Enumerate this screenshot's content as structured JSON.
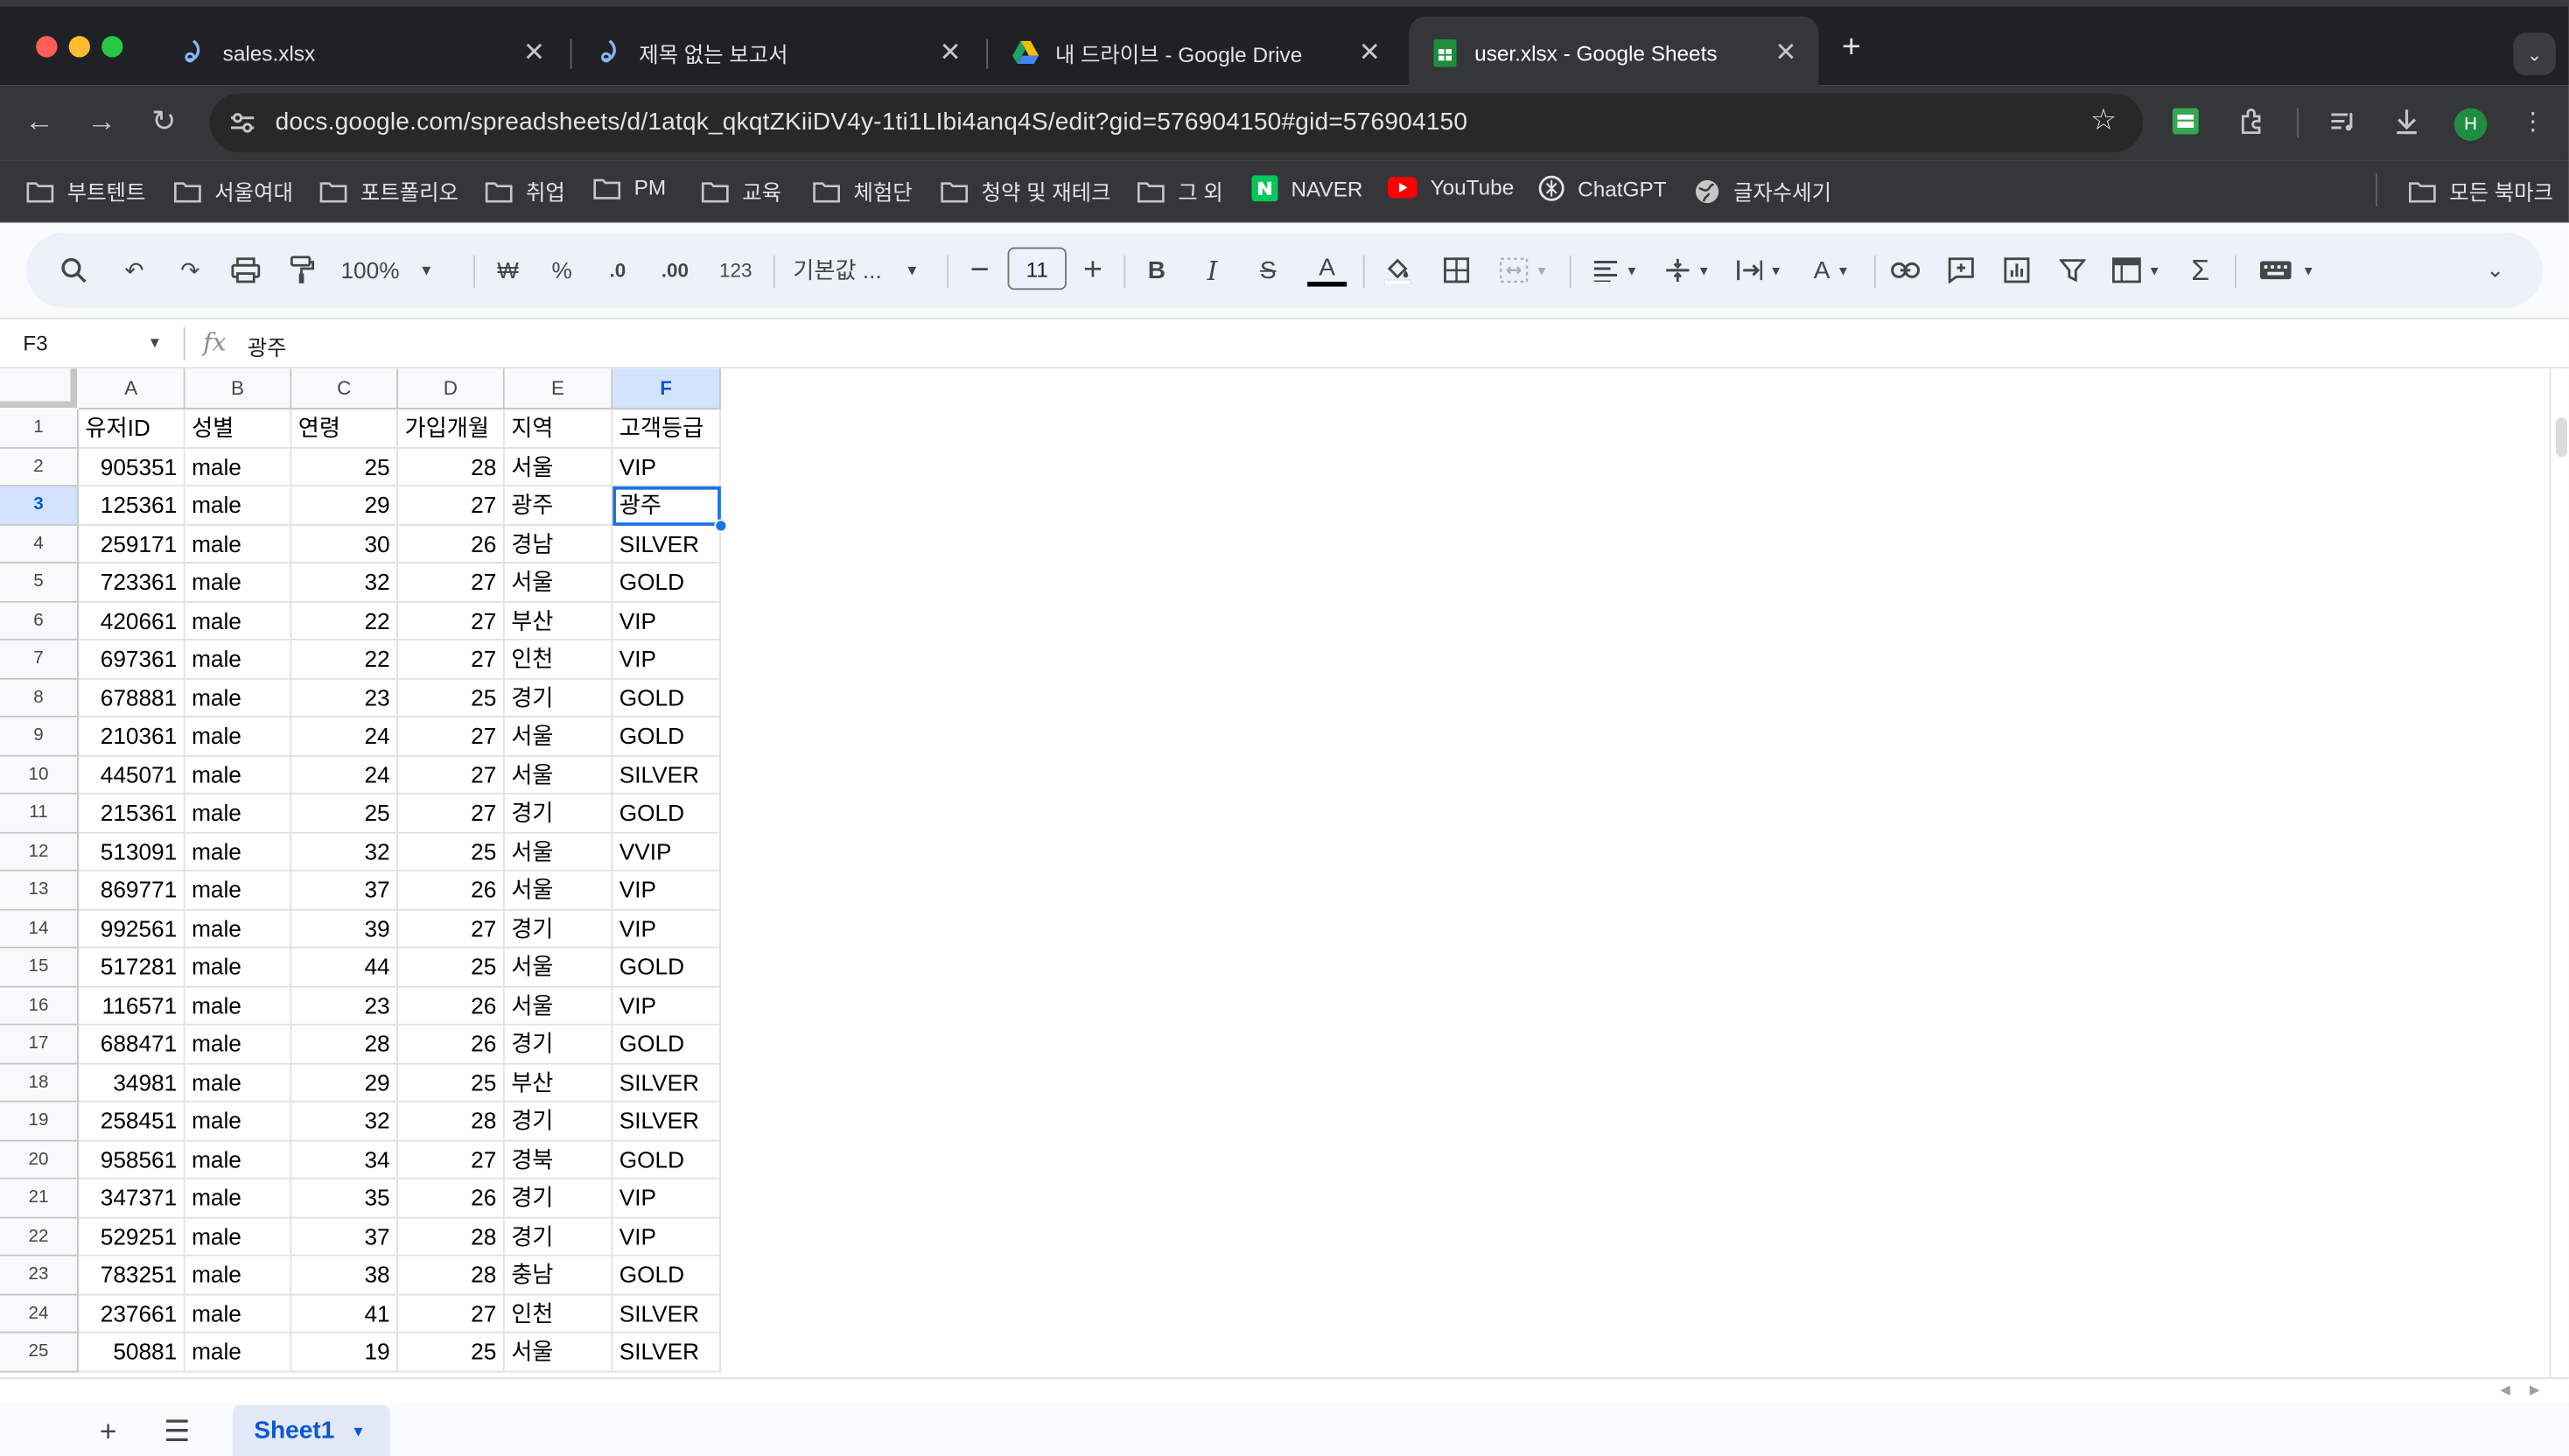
{
  "tabs": [
    {
      "title": "sales.xlsx",
      "icon": "copilot-icon"
    },
    {
      "title": "제목 없는 보고서",
      "icon": "copilot-icon"
    },
    {
      "title": "내 드라이브 - Google Drive",
      "icon": "google-drive-icon"
    },
    {
      "title": "user.xlsx - Google Sheets",
      "icon": "google-sheets-icon",
      "active": true
    }
  ],
  "omnibox": {
    "url": "docs.google.com/spreadsheets/d/1atqk_qkqtZKiiDV4y-1ti1LIbi4anq4S/edit?gid=576904150#gid=576904150"
  },
  "profile": {
    "initial": "H",
    "color": "#1e8e3e"
  },
  "bookmarks": [
    {
      "label": "부트텐트",
      "icon": "folder-icon"
    },
    {
      "label": "서울여대",
      "icon": "folder-icon"
    },
    {
      "label": "포트폴리오",
      "icon": "folder-icon"
    },
    {
      "label": "취업",
      "icon": "folder-icon"
    },
    {
      "label": "PM",
      "icon": "folder-icon"
    },
    {
      "label": "교육",
      "icon": "folder-icon"
    },
    {
      "label": "체험단",
      "icon": "folder-icon"
    },
    {
      "label": "청약 및 재테크",
      "icon": "folder-icon"
    },
    {
      "label": "그 외",
      "icon": "folder-icon"
    },
    {
      "label": "NAVER",
      "icon": "naver-icon"
    },
    {
      "label": "YouTube",
      "icon": "youtube-icon"
    },
    {
      "label": "ChatGPT",
      "icon": "chatgpt-icon"
    },
    {
      "label": "글자수세기",
      "icon": "globe-icon"
    }
  ],
  "all_bookmarks": "모든 북마크",
  "sheets_toolbar": {
    "zoom": "100%",
    "currency": "₩",
    "percent": "%",
    "decrease_decimal": ".0",
    "increase_decimal": ".00",
    "number_format": "123",
    "font": "기본값 ...",
    "font_size": "11"
  },
  "formula_bar": {
    "cell_ref": "F3",
    "value": "광주"
  },
  "columns": [
    "A",
    "B",
    "C",
    "D",
    "E",
    "F"
  ],
  "header_row": [
    "유저ID",
    "성별",
    "연령",
    "가입개월",
    "지역",
    "고객등급"
  ],
  "rows": [
    [
      "905351",
      "male",
      "25",
      "28",
      "서울",
      "VIP"
    ],
    [
      "125361",
      "male",
      "29",
      "27",
      "광주",
      "광주"
    ],
    [
      "259171",
      "male",
      "30",
      "26",
      "경남",
      "SILVER"
    ],
    [
      "723361",
      "male",
      "32",
      "27",
      "서울",
      "GOLD"
    ],
    [
      "420661",
      "male",
      "22",
      "27",
      "부산",
      "VIP"
    ],
    [
      "697361",
      "male",
      "22",
      "27",
      "인천",
      "VIP"
    ],
    [
      "678881",
      "male",
      "23",
      "25",
      "경기",
      "GOLD"
    ],
    [
      "210361",
      "male",
      "24",
      "27",
      "서울",
      "GOLD"
    ],
    [
      "445071",
      "male",
      "24",
      "27",
      "서울",
      "SILVER"
    ],
    [
      "215361",
      "male",
      "25",
      "27",
      "경기",
      "GOLD"
    ],
    [
      "513091",
      "male",
      "32",
      "25",
      "서울",
      "VVIP"
    ],
    [
      "869771",
      "male",
      "37",
      "26",
      "서울",
      "VIP"
    ],
    [
      "992561",
      "male",
      "39",
      "27",
      "경기",
      "VIP"
    ],
    [
      "517281",
      "male",
      "44",
      "25",
      "서울",
      "GOLD"
    ],
    [
      "116571",
      "male",
      "23",
      "26",
      "서울",
      "VIP"
    ],
    [
      "688471",
      "male",
      "28",
      "26",
      "경기",
      "GOLD"
    ],
    [
      "34981",
      "male",
      "29",
      "25",
      "부산",
      "SILVER"
    ],
    [
      "258451",
      "male",
      "32",
      "28",
      "경기",
      "SILVER"
    ],
    [
      "958561",
      "male",
      "34",
      "27",
      "경북",
      "GOLD"
    ],
    [
      "347371",
      "male",
      "35",
      "26",
      "경기",
      "VIP"
    ],
    [
      "529251",
      "male",
      "37",
      "28",
      "경기",
      "VIP"
    ],
    [
      "783251",
      "male",
      "38",
      "28",
      "충남",
      "GOLD"
    ],
    [
      "237661",
      "male",
      "41",
      "27",
      "인천",
      "SILVER"
    ],
    [
      "50881",
      "male",
      "19",
      "25",
      "서울",
      "SILVER"
    ]
  ],
  "selected": {
    "col": "F",
    "row": 3
  },
  "sheet_tab": "Sheet1"
}
